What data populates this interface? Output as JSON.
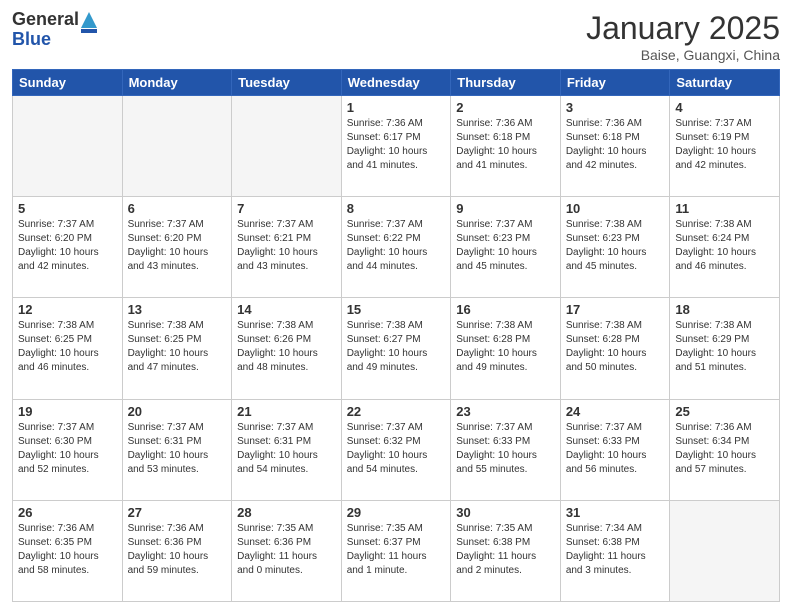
{
  "header": {
    "logo_general": "General",
    "logo_blue": "Blue",
    "month_title": "January 2025",
    "location": "Baise, Guangxi, China"
  },
  "weekdays": [
    "Sunday",
    "Monday",
    "Tuesday",
    "Wednesday",
    "Thursday",
    "Friday",
    "Saturday"
  ],
  "weeks": [
    [
      {
        "day": "",
        "info": ""
      },
      {
        "day": "",
        "info": ""
      },
      {
        "day": "",
        "info": ""
      },
      {
        "day": "1",
        "info": "Sunrise: 7:36 AM\nSunset: 6:17 PM\nDaylight: 10 hours\nand 41 minutes."
      },
      {
        "day": "2",
        "info": "Sunrise: 7:36 AM\nSunset: 6:18 PM\nDaylight: 10 hours\nand 41 minutes."
      },
      {
        "day": "3",
        "info": "Sunrise: 7:36 AM\nSunset: 6:18 PM\nDaylight: 10 hours\nand 42 minutes."
      },
      {
        "day": "4",
        "info": "Sunrise: 7:37 AM\nSunset: 6:19 PM\nDaylight: 10 hours\nand 42 minutes."
      }
    ],
    [
      {
        "day": "5",
        "info": "Sunrise: 7:37 AM\nSunset: 6:20 PM\nDaylight: 10 hours\nand 42 minutes."
      },
      {
        "day": "6",
        "info": "Sunrise: 7:37 AM\nSunset: 6:20 PM\nDaylight: 10 hours\nand 43 minutes."
      },
      {
        "day": "7",
        "info": "Sunrise: 7:37 AM\nSunset: 6:21 PM\nDaylight: 10 hours\nand 43 minutes."
      },
      {
        "day": "8",
        "info": "Sunrise: 7:37 AM\nSunset: 6:22 PM\nDaylight: 10 hours\nand 44 minutes."
      },
      {
        "day": "9",
        "info": "Sunrise: 7:37 AM\nSunset: 6:23 PM\nDaylight: 10 hours\nand 45 minutes."
      },
      {
        "day": "10",
        "info": "Sunrise: 7:38 AM\nSunset: 6:23 PM\nDaylight: 10 hours\nand 45 minutes."
      },
      {
        "day": "11",
        "info": "Sunrise: 7:38 AM\nSunset: 6:24 PM\nDaylight: 10 hours\nand 46 minutes."
      }
    ],
    [
      {
        "day": "12",
        "info": "Sunrise: 7:38 AM\nSunset: 6:25 PM\nDaylight: 10 hours\nand 46 minutes."
      },
      {
        "day": "13",
        "info": "Sunrise: 7:38 AM\nSunset: 6:25 PM\nDaylight: 10 hours\nand 47 minutes."
      },
      {
        "day": "14",
        "info": "Sunrise: 7:38 AM\nSunset: 6:26 PM\nDaylight: 10 hours\nand 48 minutes."
      },
      {
        "day": "15",
        "info": "Sunrise: 7:38 AM\nSunset: 6:27 PM\nDaylight: 10 hours\nand 49 minutes."
      },
      {
        "day": "16",
        "info": "Sunrise: 7:38 AM\nSunset: 6:28 PM\nDaylight: 10 hours\nand 49 minutes."
      },
      {
        "day": "17",
        "info": "Sunrise: 7:38 AM\nSunset: 6:28 PM\nDaylight: 10 hours\nand 50 minutes."
      },
      {
        "day": "18",
        "info": "Sunrise: 7:38 AM\nSunset: 6:29 PM\nDaylight: 10 hours\nand 51 minutes."
      }
    ],
    [
      {
        "day": "19",
        "info": "Sunrise: 7:37 AM\nSunset: 6:30 PM\nDaylight: 10 hours\nand 52 minutes."
      },
      {
        "day": "20",
        "info": "Sunrise: 7:37 AM\nSunset: 6:31 PM\nDaylight: 10 hours\nand 53 minutes."
      },
      {
        "day": "21",
        "info": "Sunrise: 7:37 AM\nSunset: 6:31 PM\nDaylight: 10 hours\nand 54 minutes."
      },
      {
        "day": "22",
        "info": "Sunrise: 7:37 AM\nSunset: 6:32 PM\nDaylight: 10 hours\nand 54 minutes."
      },
      {
        "day": "23",
        "info": "Sunrise: 7:37 AM\nSunset: 6:33 PM\nDaylight: 10 hours\nand 55 minutes."
      },
      {
        "day": "24",
        "info": "Sunrise: 7:37 AM\nSunset: 6:33 PM\nDaylight: 10 hours\nand 56 minutes."
      },
      {
        "day": "25",
        "info": "Sunrise: 7:36 AM\nSunset: 6:34 PM\nDaylight: 10 hours\nand 57 minutes."
      }
    ],
    [
      {
        "day": "26",
        "info": "Sunrise: 7:36 AM\nSunset: 6:35 PM\nDaylight: 10 hours\nand 58 minutes."
      },
      {
        "day": "27",
        "info": "Sunrise: 7:36 AM\nSunset: 6:36 PM\nDaylight: 10 hours\nand 59 minutes."
      },
      {
        "day": "28",
        "info": "Sunrise: 7:35 AM\nSunset: 6:36 PM\nDaylight: 11 hours\nand 0 minutes."
      },
      {
        "day": "29",
        "info": "Sunrise: 7:35 AM\nSunset: 6:37 PM\nDaylight: 11 hours\nand 1 minute."
      },
      {
        "day": "30",
        "info": "Sunrise: 7:35 AM\nSunset: 6:38 PM\nDaylight: 11 hours\nand 2 minutes."
      },
      {
        "day": "31",
        "info": "Sunrise: 7:34 AM\nSunset: 6:38 PM\nDaylight: 11 hours\nand 3 minutes."
      },
      {
        "day": "",
        "info": ""
      }
    ]
  ]
}
